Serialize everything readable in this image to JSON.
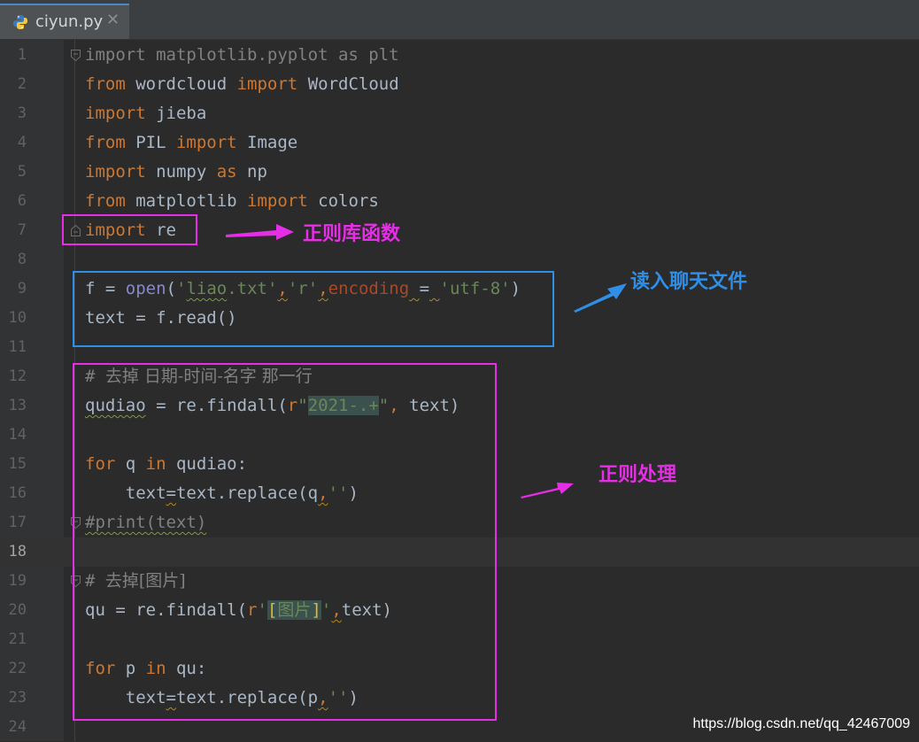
{
  "tab": {
    "filename": "ciyun.py",
    "icon": "python-file-icon",
    "close": "✕"
  },
  "colors": {
    "magenta": "#e62ee6",
    "blue": "#2f8fe6",
    "keyword": "#cc7832",
    "string": "#6a8759"
  },
  "lines": [
    {
      "n": "1",
      "code": "import matplotlib.pyplot as plt"
    },
    {
      "n": "2",
      "code": "from wordcloud import WordCloud"
    },
    {
      "n": "3",
      "code": "import jieba"
    },
    {
      "n": "4",
      "code": "from PIL import Image"
    },
    {
      "n": "5",
      "code": "import numpy as np"
    },
    {
      "n": "6",
      "code": "from matplotlib import colors"
    },
    {
      "n": "7",
      "code": "import re"
    },
    {
      "n": "8",
      "code": ""
    },
    {
      "n": "9",
      "code": "f = open('liao.txt','r',encoding = 'utf-8')"
    },
    {
      "n": "10",
      "code": "text = f.read()"
    },
    {
      "n": "11",
      "code": ""
    },
    {
      "n": "12",
      "code": "# 去掉 日期-时间-名字 那一行"
    },
    {
      "n": "13",
      "code": "qudiao = re.findall(r\"2021-.+\", text)"
    },
    {
      "n": "14",
      "code": ""
    },
    {
      "n": "15",
      "code": "for q in qudiao:"
    },
    {
      "n": "16",
      "code": "    text=text.replace(q,'')"
    },
    {
      "n": "17",
      "code": "#print(text)"
    },
    {
      "n": "18",
      "code": ""
    },
    {
      "n": "19",
      "code": "# 去掉[图片]"
    },
    {
      "n": "20",
      "code": "qu = re.findall(r'[图片]',text)"
    },
    {
      "n": "21",
      "code": ""
    },
    {
      "n": "22",
      "code": "for p in qu:"
    },
    {
      "n": "23",
      "code": "    text=text.replace(p,'')"
    },
    {
      "n": "24",
      "code": ""
    }
  ],
  "annotations": {
    "regex_lib": "正则库函数",
    "read_file": "读入聊天文件",
    "regex_process": "正则处理"
  },
  "watermark": "https://blog.csdn.net/qq_42467009"
}
